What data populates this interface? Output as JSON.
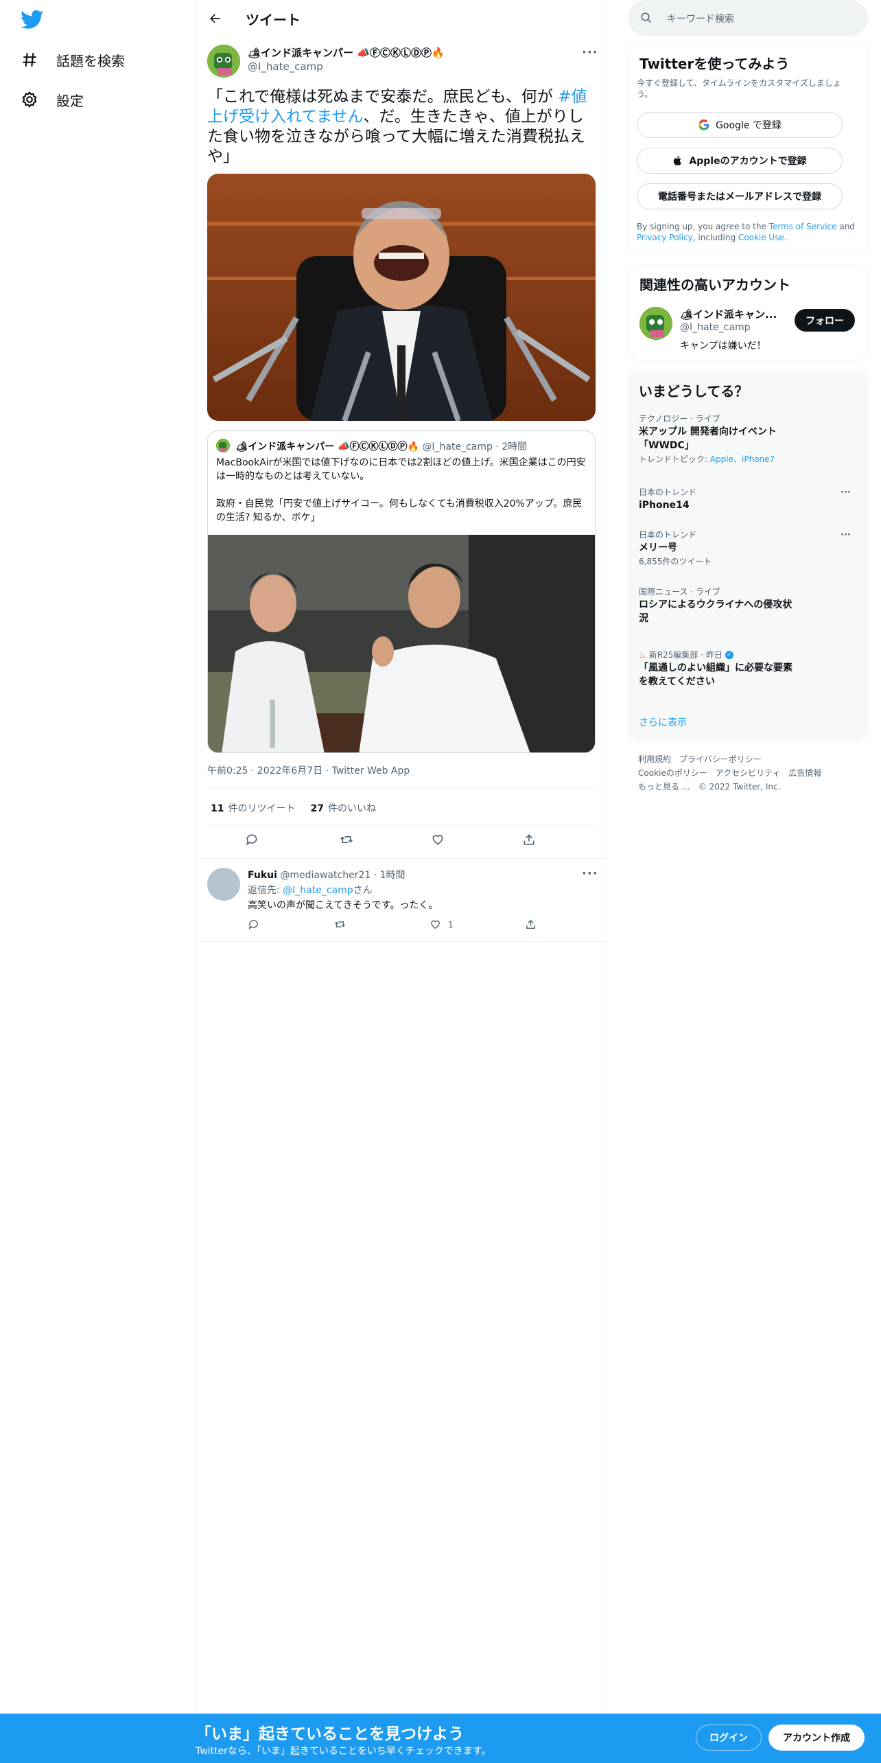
{
  "nav": {
    "explore_label": "話題を検索",
    "settings_label": "設定"
  },
  "header": {
    "title": "ツイート"
  },
  "tweet": {
    "author_name": "🏕インド派キャンパー 📣ⒻⒸⓀⓁⒹⓅ🔥",
    "author_handle": "@I_hate_camp",
    "text_before": "「これで俺様は死ぬまで安泰だ。庶民ども、何が ",
    "hashtag": "#値上げ受け入れてません",
    "text_after": "、だ。生きたきゃ、値上がりした食い物を泣きながら喰って大幅に増えた消費税払えや」",
    "meta": "午前0:25 · 2022年6月7日 · Twitter Web App",
    "retweet_count": "11",
    "retweet_label": "件のリツイート",
    "like_count": "27",
    "like_label": "件のいいね"
  },
  "quote": {
    "author_name": "🏕インド派キャンパー 📣ⒻⒸⓀⓁⒹⓅ🔥",
    "handle_time": "@I_hate_camp · 2時間",
    "body": "MacBookAirが米国では値下げなのに日本では2割ほどの値上げ。米国企業はこの円安は一時的なものとは考えていない。\n\n政府・自民党「円安で値上げサイコー。何もしなくても消費税収入20%アップ。庶民の生活? 知るか、ボケ」"
  },
  "reply": {
    "name": "Fukui",
    "handle_time": "@mediawatcher21 · 1時間",
    "reply_to_prefix": "返信先: ",
    "reply_to_handle": "@I_hate_camp",
    "reply_to_suffix": "さん",
    "text": "高笑いの声が聞こえてきそうです。ったく。",
    "like_count": "1"
  },
  "search": {
    "placeholder": "キーワード検索"
  },
  "signup_panel": {
    "title": "Twitterを使ってみよう",
    "subtitle": "今すぐ登録して、タイムラインをカスタマイズしましょう。",
    "google_label": "Google で登録",
    "apple_label": "Appleのアカウントで登録",
    "phone_label": "電話番号またはメールアドレスで登録",
    "terms_prefix": "By signing up, you agree to the ",
    "terms_link": "Terms of Service",
    "terms_and": " and ",
    "privacy_link": "Privacy Policy",
    "terms_including": ", including ",
    "cookie_link": "Cookie Use",
    "terms_end": "."
  },
  "related_panel": {
    "title": "関連性の高いアカウント",
    "name": "🏕インド派キャン...",
    "handle": "@I_hate_camp",
    "bio": "キャンプは嫌いだ！",
    "follow_label": "フォロー"
  },
  "trends_panel": {
    "title": "いまどうしてる？",
    "items": [
      {
        "category": "テクノロジー · ライブ",
        "title": "米アップル 開発者向けイベント「WWDC」",
        "sub_prefix": "トレンドトピック: ",
        "sub_links": "Apple、iPhone7"
      },
      {
        "category": "日本のトレンド",
        "title": "iPhone14"
      },
      {
        "category": "日本のトレンド",
        "title": "メリー号",
        "sub": "6,855件のツイート"
      },
      {
        "category": "国際ニュース · ライブ",
        "title": "ロシアによるウクライナへの侵攻状況"
      },
      {
        "category": "新R25編集部 · 昨日",
        "title": "「風通しのよい組織」に必要な要素を教えてください"
      }
    ],
    "show_more": "さらに表示"
  },
  "footer": {
    "terms": "利用規約",
    "privacy": "プライバシーポリシー",
    "cookie": "Cookieのポリシー",
    "accessibility": "アクセシビリティ",
    "ads": "広告情報",
    "more": "もっと見る …",
    "copyright": "© 2022 Twitter, Inc."
  },
  "bottom_bar": {
    "title": "「いま」起きていることを見つけよう",
    "subtitle": "Twitterなら、「いま」起きていることをいち早くチェックできます。",
    "login_label": "ログイン",
    "signup_label": "アカウント作成"
  },
  "colors": {
    "accent": "#1d9bf0",
    "text": "#0f1419",
    "secondary": "#536471",
    "border": "#eff3f4"
  }
}
